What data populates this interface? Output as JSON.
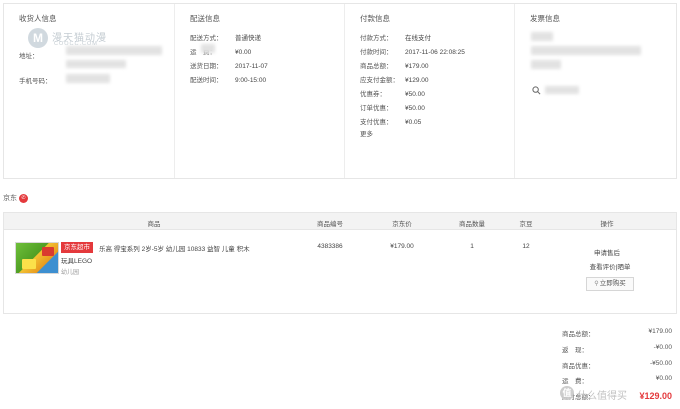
{
  "receiver": {
    "title": "收货人信息",
    "address_label": "地址：",
    "phone_label": "手机号码："
  },
  "watermark": {
    "logo_char": "M",
    "text": "漫天猫动漫",
    "sub": "COOCC.COM"
  },
  "delivery": {
    "title": "配送信息",
    "rows": [
      {
        "k": "配送方式：",
        "v": "普通快递"
      },
      {
        "k": "运　费：",
        "v": "¥0.00"
      },
      {
        "k": "送货日期：",
        "v": "2017-11-07"
      },
      {
        "k": "配送时间：",
        "v": "9:00-15:00"
      }
    ]
  },
  "payment": {
    "title": "付款信息",
    "rows": [
      {
        "k": "付款方式：",
        "v": "在线支付"
      },
      {
        "k": "付款时间：",
        "v": "2017-11-06 22:08:25"
      },
      {
        "k": "商品总额：",
        "v": "¥179.00"
      },
      {
        "k": "应支付金额：",
        "v": "¥129.00"
      },
      {
        "k": "优惠券：",
        "v": "¥50.00"
      },
      {
        "k": "订单优惠：",
        "v": "¥50.00"
      },
      {
        "k": "支付优惠：",
        "v": "¥0.05"
      }
    ],
    "more": "更多"
  },
  "invoice": {
    "title": "发票信息"
  },
  "shop": {
    "name": "京东",
    "icon": "jd-chat-icon"
  },
  "table": {
    "headers": {
      "product": "商品",
      "sku": "商品编号",
      "price": "京东价",
      "qty": "商品数量",
      "beans": "京豆",
      "ops": "操作"
    },
    "row": {
      "tag": "京东超市",
      "name_line1": "乐高 得宝系列 2岁-5岁 幼儿园 10833 益智 儿童 积木",
      "name_line2": "玩具LEGO",
      "shop_name": "幼儿园",
      "sku": "4383386",
      "price": "¥179.00",
      "qty": "1",
      "beans": "12",
      "after_sale": "申请售后",
      "review": "查看评价|晒单",
      "buy_again": "立即购买"
    }
  },
  "summary": {
    "rows": [
      {
        "k": "商品总额：",
        "v": "¥179.00"
      },
      {
        "k": "返　现：",
        "v": "-¥0.00"
      },
      {
        "k": "商品优惠：",
        "v": "-¥50.00"
      },
      {
        "k": "运　费：",
        "v": "¥0.00"
      },
      {
        "k": "应付总额：",
        "v": "¥129.00"
      }
    ]
  },
  "site_watermark": {
    "icon_char": "值",
    "text": "什么值得买"
  },
  "colors": {
    "accent_red": "#e4393c",
    "border": "#e6e6e6",
    "header_bg": "#f3f3f3"
  }
}
